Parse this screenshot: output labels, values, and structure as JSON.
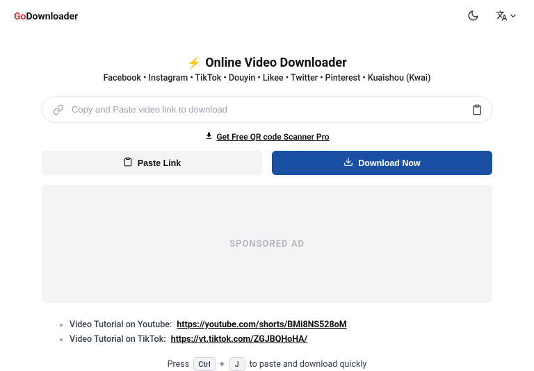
{
  "brand": {
    "go": "Go",
    "name": "Downloader"
  },
  "hero": {
    "title": "Online Video Downloader",
    "subtitle": "Facebook • Instagram • TikTok • Douyin • Likee • Twitter • Pinterest • Kuaishou (Kwai)"
  },
  "input": {
    "placeholder": "Copy and Paste video link to download"
  },
  "promo": {
    "text": "Get Free QR code Scanner Pro"
  },
  "buttons": {
    "paste": "Paste Link",
    "download": "Download Now"
  },
  "ad": {
    "label": "SPONSORED AD"
  },
  "tutorials": {
    "yt_label": "Video Tutorial on Youtube:",
    "yt_link": "https://youtube.com/shorts/BMi8NS528oM",
    "tt_label": "Video Tutorial on TikTok:",
    "tt_link": "https://vt.tiktok.com/ZGJBQHoHA/"
  },
  "shortcut": {
    "press": "Press",
    "ctrl": "Ctrl",
    "plus": "+",
    "j": "J",
    "rest": "to paste and download quickly"
  }
}
